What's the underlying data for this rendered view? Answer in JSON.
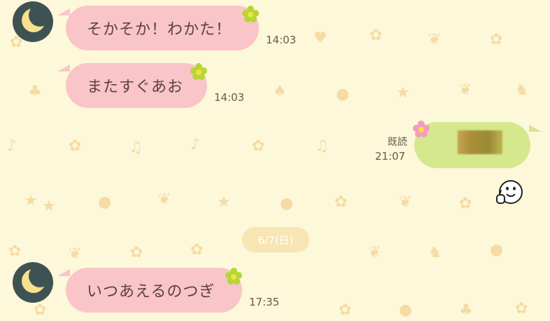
{
  "messages": [
    {
      "text": "そかそか！わかた！",
      "time": "14:03"
    },
    {
      "text": "またすぐあお",
      "time": "14:03"
    },
    {
      "text": "いつあえるのつぎ",
      "time": "17:35"
    }
  ],
  "outgoing": {
    "read_label": "既読",
    "time": "21:07"
  },
  "date_separator": "6/7(日)",
  "icons": {
    "avatar": "crescent-moon-icon",
    "sticker": "thumbs-up-face-icon"
  },
  "colors": {
    "background": "#fdf8d9",
    "incoming_bubble": "#f9c5c8",
    "outgoing_bubble": "#d6e88d",
    "avatar_bg": "#3f5253"
  }
}
